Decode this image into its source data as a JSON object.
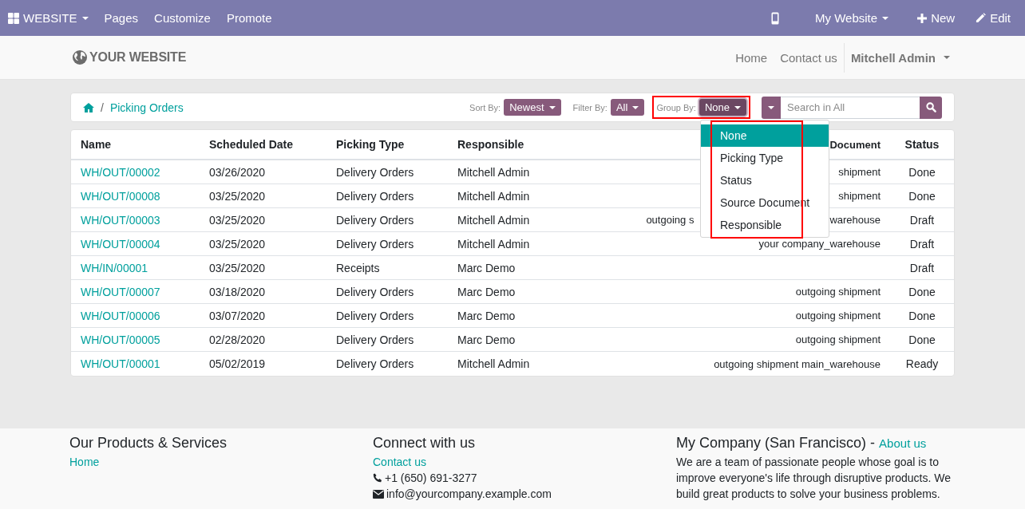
{
  "topbar": {
    "app_menu": "WEBSITE",
    "items": [
      "Pages",
      "Customize",
      "Promote"
    ],
    "website_menu": "My Website",
    "new": "New",
    "edit": "Edit"
  },
  "header": {
    "logo": "YOUR WEBSITE",
    "nav": [
      "Home",
      "Contact us"
    ],
    "user": "Mitchell Admin"
  },
  "breadcrumb": {
    "separator": "/",
    "items": [
      "Picking Orders"
    ]
  },
  "toolbar": {
    "sort": {
      "label": "Sort By:",
      "value": "Newest"
    },
    "filter": {
      "label": "Filter By:",
      "value": "All"
    },
    "group": {
      "label": "Group By:",
      "value": "None",
      "highlighted": true
    },
    "search": {
      "placeholder": "Search in All"
    }
  },
  "group_menu": {
    "highlighted": true,
    "items": [
      {
        "label": "None",
        "selected": true
      },
      {
        "label": "Picking Type",
        "selected": false
      },
      {
        "label": "Status",
        "selected": false
      },
      {
        "label": "Source Document",
        "selected": false
      },
      {
        "label": "Responsible",
        "selected": false
      }
    ]
  },
  "table": {
    "columns": [
      "Name",
      "Scheduled Date",
      "Picking Type",
      "Responsible",
      "Document",
      "Status"
    ],
    "rows": [
      {
        "name": "WH/OUT/00002",
        "date": "03/26/2020",
        "type": "Delivery Orders",
        "responsible": "Mitchell Admin",
        "source": [
          "shipment"
        ],
        "status": "Done"
      },
      {
        "name": "WH/OUT/00008",
        "date": "03/25/2020",
        "type": "Delivery Orders",
        "responsible": "Mitchell Admin",
        "source": [
          "shipment"
        ],
        "status": "Done"
      },
      {
        "name": "WH/OUT/00003",
        "date": "03/25/2020",
        "type": "Delivery Orders",
        "responsible": "Mitchell Admin",
        "source": [
          "outgoing s",
          "warehouse"
        ],
        "status": "Draft"
      },
      {
        "name": "WH/OUT/00004",
        "date": "03/25/2020",
        "type": "Delivery Orders",
        "responsible": "Mitchell Admin",
        "source": [
          "your company_warehouse"
        ],
        "status": "Draft"
      },
      {
        "name": "WH/IN/00001",
        "date": "03/25/2020",
        "type": "Receipts",
        "responsible": "Marc Demo",
        "status": "Draft"
      },
      {
        "name": "WH/OUT/00007",
        "date": "03/18/2020",
        "type": "Delivery Orders",
        "responsible": "Marc Demo",
        "source": [
          "outgoing shipment"
        ],
        "status": "Done"
      },
      {
        "name": "WH/OUT/00006",
        "date": "03/07/2020",
        "type": "Delivery Orders",
        "responsible": "Marc Demo",
        "source": [
          "outgoing shipment"
        ],
        "status": "Done"
      },
      {
        "name": "WH/OUT/00005",
        "date": "02/28/2020",
        "type": "Delivery Orders",
        "responsible": "Marc Demo",
        "source": [
          "outgoing shipment"
        ],
        "status": "Done"
      },
      {
        "name": "WH/OUT/00001",
        "date": "05/02/2019",
        "type": "Delivery Orders",
        "responsible": "Mitchell Admin",
        "source": [
          "outgoing shipment main_warehouse"
        ],
        "status": "Ready"
      }
    ]
  },
  "footer": {
    "columns": [
      {
        "title": "Our Products & Services",
        "links": [
          "Home"
        ]
      },
      {
        "title": "Connect with us",
        "links": [
          "Contact us"
        ],
        "phone": "+1 (650) 691-3277",
        "email": "info@yourcompany.example.com"
      },
      {
        "title": "My Company (San Francisco) -",
        "title_link": "About us",
        "text": "We are a team of passionate people whose goal is to improve everyone's life through disruptive products. We build great products to solve your business problems."
      }
    ]
  }
}
